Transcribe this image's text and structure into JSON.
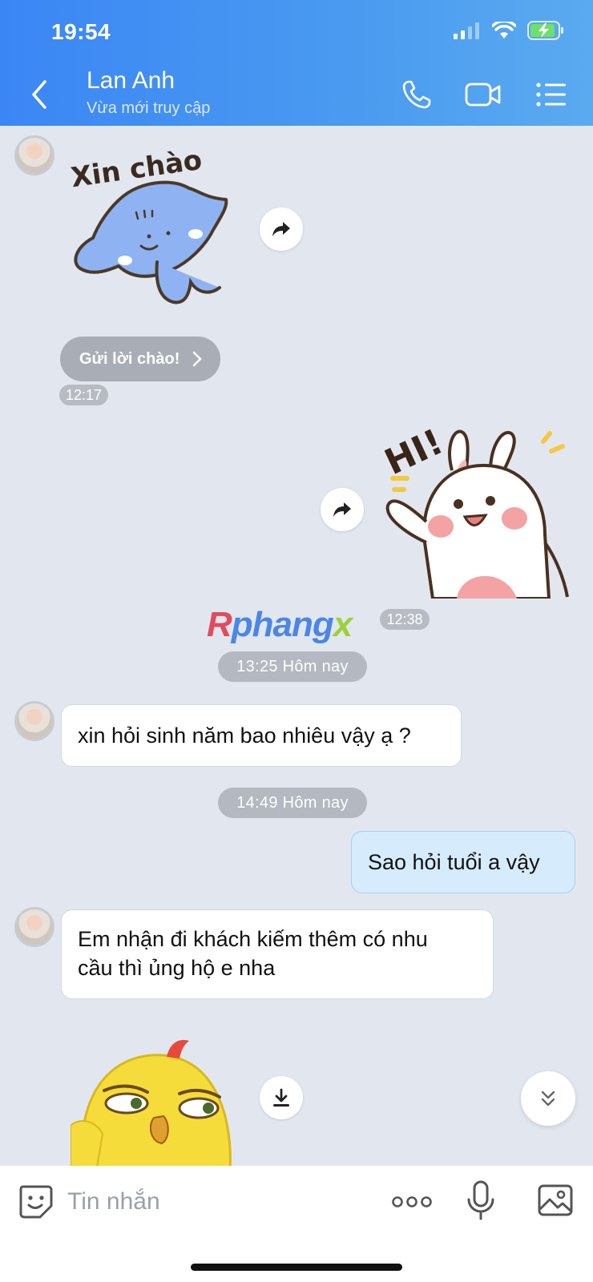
{
  "status_bar": {
    "time": "19:54"
  },
  "header": {
    "contact_name": "Lan Anh",
    "contact_status": "Vừa mới truy cập",
    "buttons": [
      "back-icon",
      "phone-icon",
      "video-call-icon",
      "menu-list-icon"
    ]
  },
  "chat": {
    "sticker_text_1": "Xin chào",
    "greet_button_label": "Gửi lời chào!",
    "time_1": "12:17",
    "sticker_text_2": "HI!",
    "watermark": [
      "R",
      "phang",
      "x"
    ],
    "time_2": "12:38",
    "date_1": "13:25 Hôm nay",
    "msg_1": "xin hỏi sinh năm bao nhiêu vậy ạ ?",
    "date_2": "14:49 Hôm nay",
    "msg_2": "Sao hỏi tuổi a vậy",
    "msg_3_line1": "Em nhận đi khách kiếm thêm có nhu",
    "msg_3_line2": "cầu thì ủng hộ e nha"
  },
  "input": {
    "placeholder": "Tin nhắn"
  },
  "colors": {
    "header_start": "#3b86f5",
    "header_end": "#5aaaf0",
    "chat_bg": "#e2e7ef",
    "my_bubble": "#d6ebfc"
  }
}
